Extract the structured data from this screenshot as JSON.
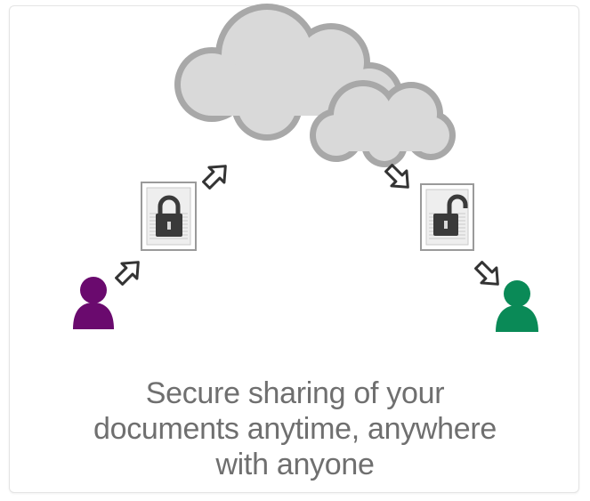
{
  "caption": {
    "line1": "Secure sharing of your",
    "line2": "documents anytime, anywhere",
    "line3": "with anyone"
  },
  "colors": {
    "sender": "#6a0a6e",
    "receiver": "#0a8a57",
    "cloud_fill": "#d9d9d9",
    "cloud_stroke": "#a8a8a8",
    "caption_text": "#6f6f6f",
    "lock": "#3a3a3a"
  },
  "icons": {
    "sender": "user-icon",
    "receiver": "user-icon",
    "locked_document": "locked-padlock-document-icon",
    "unlocked_document": "unlocked-padlock-document-icon",
    "cloud": "cloud-icon",
    "arrows": "outline-arrow-icon"
  }
}
